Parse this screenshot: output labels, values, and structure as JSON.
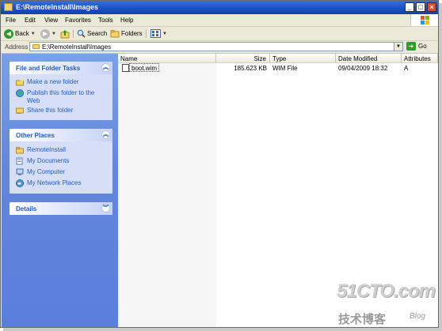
{
  "window": {
    "title": "E:\\RemoteInstall\\Images",
    "controls": {
      "minimize": "_",
      "maximize": "□",
      "close": "×"
    }
  },
  "menubar": {
    "items": [
      "File",
      "Edit",
      "View",
      "Favorites",
      "Tools",
      "Help"
    ]
  },
  "toolbar": {
    "back_label": "Back",
    "search_label": "Search",
    "folders_label": "Folders"
  },
  "address": {
    "label": "Address",
    "value": "E:\\RemoteInstall\\Images",
    "go_label": "Go"
  },
  "taskpane": {
    "file_tasks": {
      "title": "File and Folder Tasks",
      "items": [
        {
          "label": "Make a new folder",
          "icon": "new-folder-icon"
        },
        {
          "label": "Publish this folder to the Web",
          "icon": "globe-icon"
        },
        {
          "label": "Share this folder",
          "icon": "share-folder-icon"
        }
      ]
    },
    "other_places": {
      "title": "Other Places",
      "items": [
        {
          "label": "RemoteInstall",
          "icon": "folder-icon"
        },
        {
          "label": "My Documents",
          "icon": "documents-icon"
        },
        {
          "label": "My Computer",
          "icon": "computer-icon"
        },
        {
          "label": "My Network Places",
          "icon": "network-icon"
        }
      ]
    },
    "details": {
      "title": "Details"
    }
  },
  "filelist": {
    "columns": [
      "Name",
      "Size",
      "Type",
      "Date Modified",
      "Attributes"
    ],
    "rows": [
      {
        "name": "boot.wim",
        "size": "185.623 KB",
        "type": "WIM File",
        "date": "09/04/2009 18:32",
        "attributes": "A"
      }
    ]
  },
  "watermark": {
    "brand": "51CTO.com",
    "chinese": "技术博客",
    "blog": "Blog"
  },
  "colors": {
    "titlebar": "#1a4fc0",
    "taskpane_bg": "#6487dc",
    "link": "#215dc6",
    "chrome": "#ece9d8"
  }
}
